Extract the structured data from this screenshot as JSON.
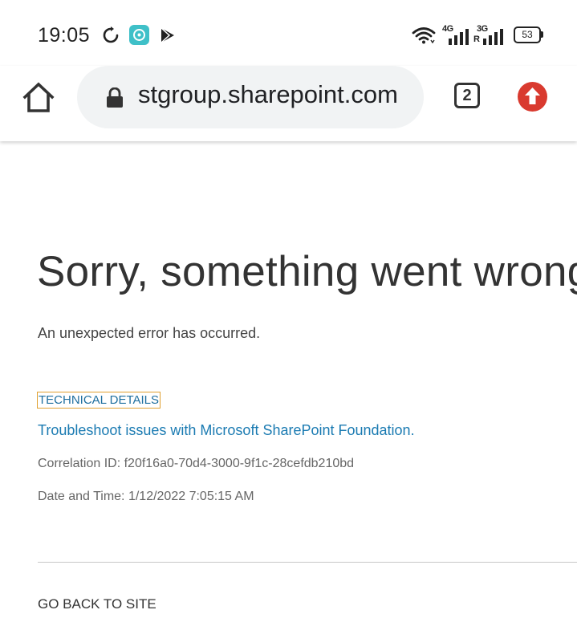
{
  "status_bar": {
    "time": "19:05",
    "network_1": "4G",
    "network_2": "3G",
    "network_2_roaming": "R",
    "battery_level": "53",
    "icons": [
      "sync-icon",
      "app-notification-icon",
      "play-store-icon",
      "wifi-icon",
      "signal-4g-icon",
      "signal-3g-icon",
      "battery-icon"
    ]
  },
  "browser": {
    "url_text": "stgroup.sharepoint.com",
    "tab_count": "2",
    "icons": [
      "home-icon",
      "lock-icon",
      "tab-switcher-icon",
      "update-arrow-icon"
    ],
    "colors": {
      "omnibox_bg": "#f1f3f4",
      "update_badge": "#d93a2f"
    }
  },
  "page": {
    "title": "Sorry, something went wrong",
    "message": "An unexpected error has occurred.",
    "technical_details_label": "TECHNICAL DETAILS",
    "troubleshoot_link": "Troubleshoot issues with Microsoft SharePoint Foundation.",
    "correlation_id": "Correlation ID: f20f16a0-70d4-3000-9f1c-28cefdb210bd",
    "date_time": "Date and Time: 1/12/2022 7:05:15 AM",
    "go_back_label": "GO BACK TO SITE",
    "colors": {
      "link": "#1b7bb2",
      "focus_outline": "#e0a030"
    }
  }
}
